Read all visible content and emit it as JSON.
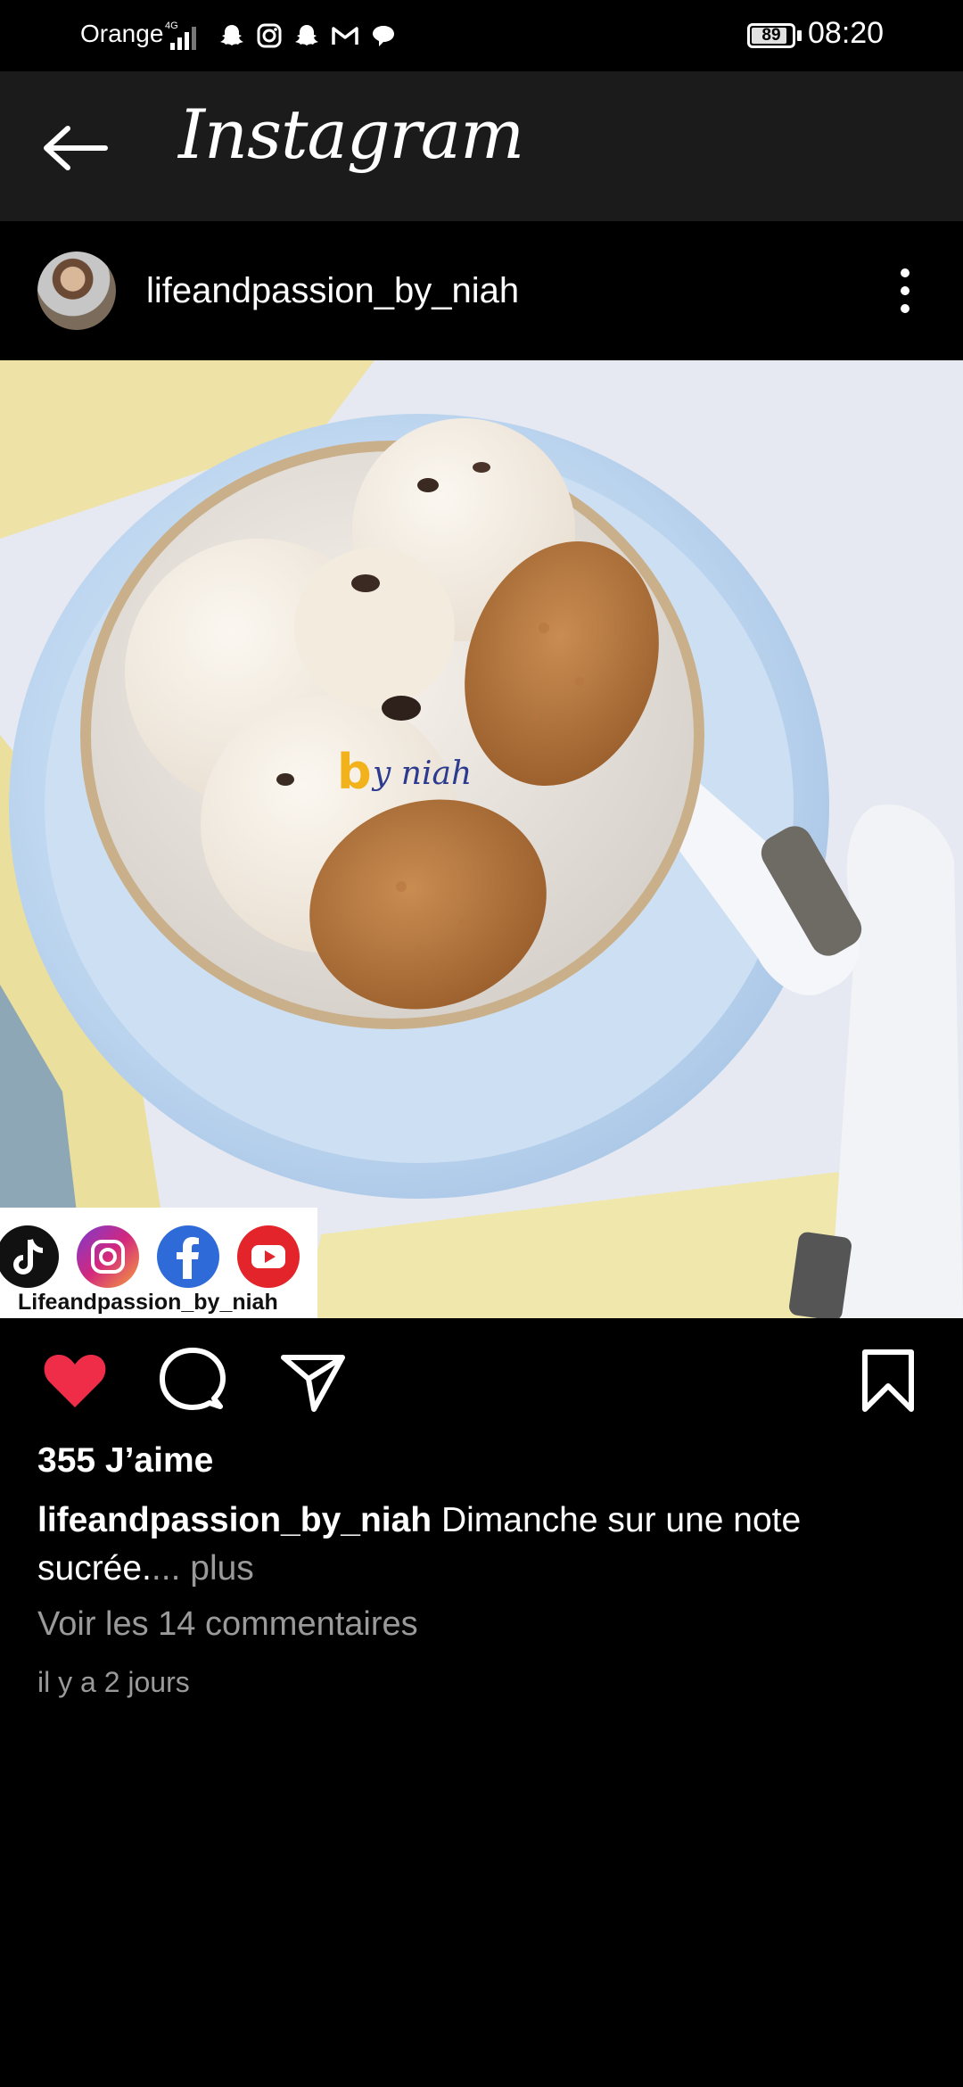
{
  "status_bar": {
    "carrier": "Orange",
    "network": "4G",
    "battery": "89",
    "time": "08:20"
  },
  "header": {
    "title": "Instagram"
  },
  "post": {
    "username": "lifeandpassion_by_niah",
    "image": {
      "watermark": "by niah",
      "social_handle": "Lifeandpassion_by_niah"
    },
    "liked": true,
    "likes": "355 J’aime",
    "caption_user": "lifeandpassion_by_niah",
    "caption_text": "Dimanche sur une note sucrée.",
    "caption_more": "... plus",
    "comments_link": "Voir les 14 commentaires",
    "time_ago": "il y a 2 jours"
  },
  "colors": {
    "like_red": "#ef2d48",
    "secondary_text": "#9a9a9a",
    "header_bg": "#1b1b1b"
  },
  "icons": [
    "back-arrow-icon",
    "more-vertical-icon",
    "heart-icon",
    "comment-icon",
    "share-icon",
    "bookmark-icon"
  ]
}
